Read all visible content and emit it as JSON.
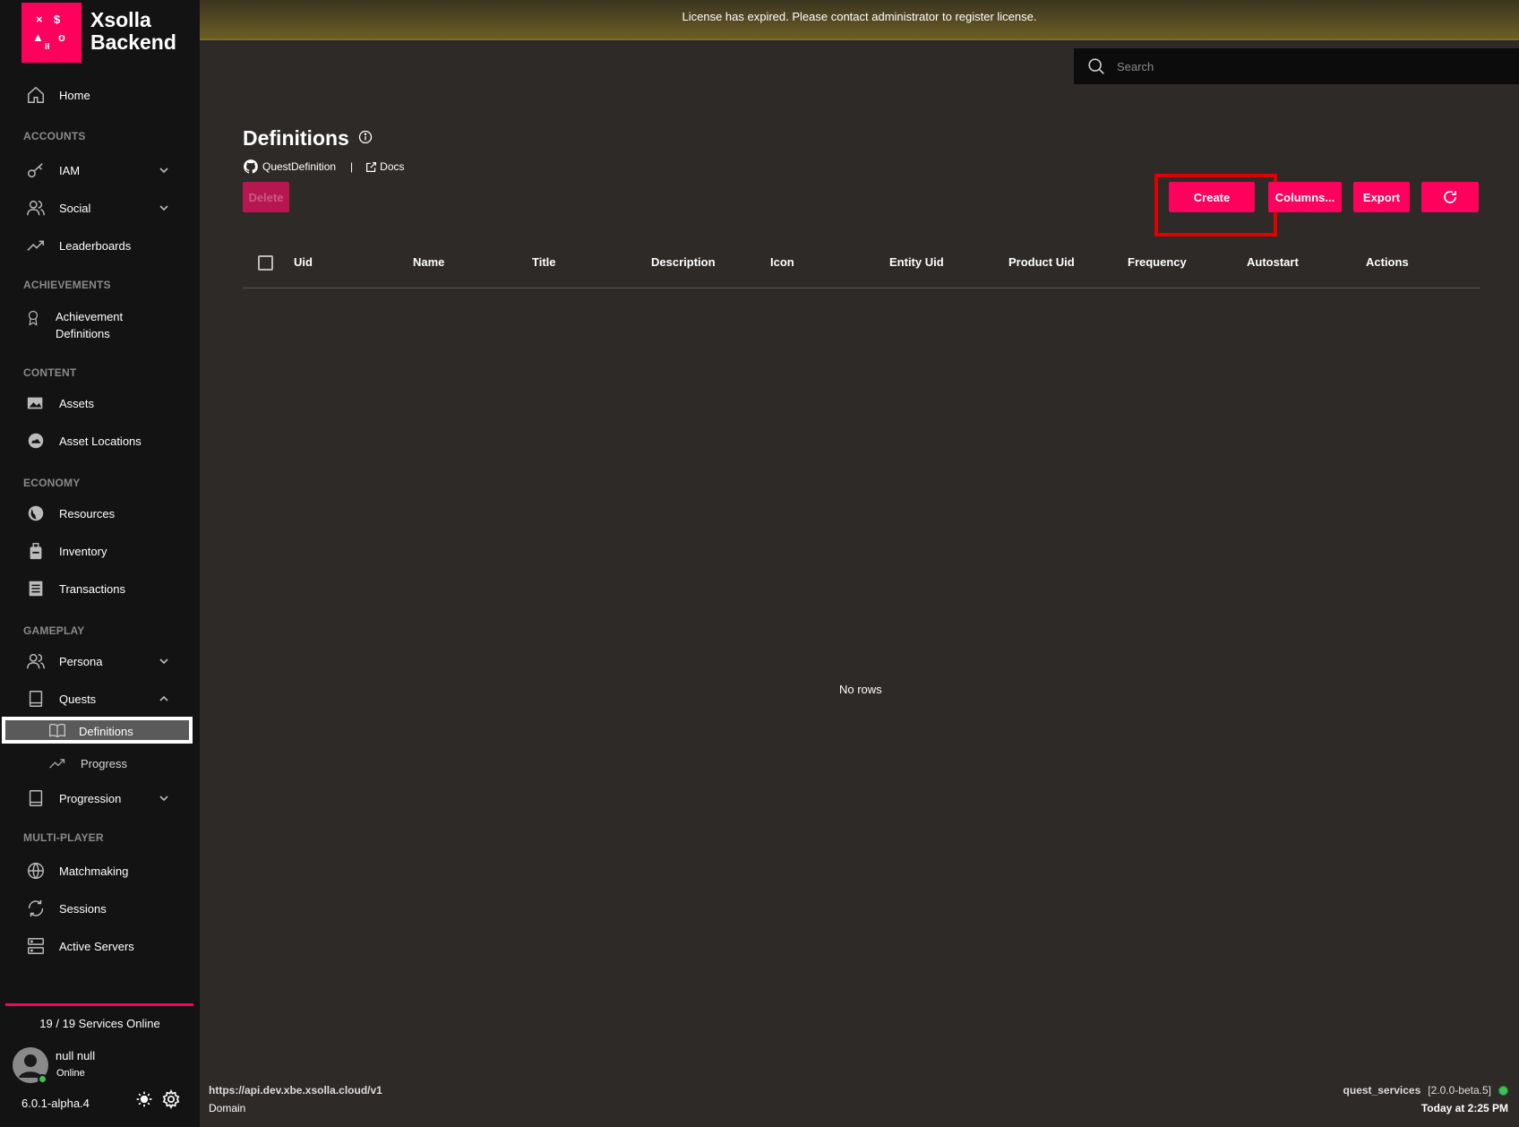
{
  "app": {
    "brand_line1": "Xsolla",
    "brand_line2": "Backend",
    "accent_color": "#ff005c",
    "logo_icon": "xsolla-logo-icon"
  },
  "banner": {
    "text": "License has expired. Please contact administrator to register license."
  },
  "search": {
    "placeholder": "Search"
  },
  "sidebar": {
    "home": "Home",
    "sections": {
      "accounts": "ACCOUNTS",
      "achievements": "ACHIEVEMENTS",
      "content": "CONTENT",
      "economy": "ECONOMY",
      "gameplay": "GAMEPLAY",
      "multiplayer": "MULTI-PLAYER"
    },
    "items": {
      "iam": "IAM",
      "social": "Social",
      "leaderboards": "Leaderboards",
      "achievement_definitions_1": "Achievement",
      "achievement_definitions_2": "Definitions",
      "assets": "Assets",
      "asset_locations": "Asset Locations",
      "resources": "Resources",
      "inventory": "Inventory",
      "transactions": "Transactions",
      "persona": "Persona",
      "quests": "Quests",
      "quests_definitions": "Definitions",
      "quests_progress": "Progress",
      "progression": "Progression",
      "matchmaking": "Matchmaking",
      "sessions": "Sessions",
      "active_servers": "Active Servers"
    },
    "services_online": "19 / 19 Services Online",
    "user": {
      "name": "null null",
      "status": "Online",
      "status_color": "#3ac455"
    },
    "version": "6.0.1-alpha.4"
  },
  "page": {
    "title": "Definitions",
    "github_link": "QuestDefinition",
    "separator": "|",
    "docs_link": "Docs",
    "buttons": {
      "delete": "Delete",
      "create": "Create",
      "columns": "Columns...",
      "export": "Export"
    },
    "table": {
      "columns": [
        "Uid",
        "Name",
        "Title",
        "Description",
        "Icon",
        "Entity Uid",
        "Product Uid",
        "Frequency",
        "Autostart",
        "Actions"
      ],
      "empty_text": "No rows"
    }
  },
  "footer": {
    "api_url": "https://api.dev.xbe.xsolla.cloud/v1",
    "domain_label": "Domain",
    "service_name": "quest_services",
    "service_version": "[2.0.0-beta.5]",
    "timestamp": "Today at 2:25 PM"
  }
}
